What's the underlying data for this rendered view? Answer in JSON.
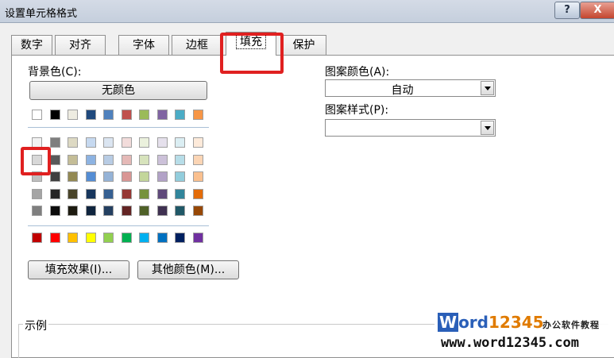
{
  "window": {
    "title": "设置单元格格式",
    "help_label": "?",
    "close_label": "X"
  },
  "tabs": [
    {
      "label": "数字"
    },
    {
      "label": "对齐"
    },
    {
      "label": "字体"
    },
    {
      "label": "边框"
    },
    {
      "label": "填充",
      "active": true
    },
    {
      "label": "保护"
    }
  ],
  "background": {
    "label": "背景色(C):",
    "no_color_button": "无颜色",
    "theme_row": [
      "#ffffff",
      "#000000",
      "#eeece1",
      "#1f497d",
      "#4f81bd",
      "#c0504d",
      "#9bbb59",
      "#8064a2",
      "#4bacc6",
      "#f79646"
    ],
    "shade_rows": [
      [
        "#f2f2f2",
        "#7f7f7f",
        "#ddd9c3",
        "#c6d9f0",
        "#dbe5f1",
        "#f2dcdb",
        "#ebf1dd",
        "#e5e0ec",
        "#dbeef3",
        "#fdeada"
      ],
      [
        "#d8d8d8",
        "#595959",
        "#c4bd97",
        "#8db3e2",
        "#b8cce4",
        "#e5b9b7",
        "#d7e3bc",
        "#ccc1d9",
        "#b7dde8",
        "#fbd5b5"
      ],
      [
        "#bfbfbf",
        "#3f3f3f",
        "#938953",
        "#548dd4",
        "#95b3d7",
        "#d99694",
        "#c3d69b",
        "#b2a2c7",
        "#92cddc",
        "#fac08f"
      ],
      [
        "#a5a5a5",
        "#262626",
        "#494429",
        "#17365d",
        "#366092",
        "#953734",
        "#76923c",
        "#5f497a",
        "#31859b",
        "#e36c09"
      ],
      [
        "#7f7f7f",
        "#0c0c0c",
        "#1d1b10",
        "#0f243e",
        "#244061",
        "#632423",
        "#4f6128",
        "#3f3151",
        "#205867",
        "#974806"
      ]
    ],
    "standard_row": [
      "#c00000",
      "#ff0000",
      "#ffc000",
      "#ffff00",
      "#92d050",
      "#00b050",
      "#00b0f0",
      "#0070c0",
      "#002060",
      "#7030a0"
    ]
  },
  "pattern": {
    "color_label": "图案颜色(A):",
    "color_value": "自动",
    "style_label": "图案样式(P):",
    "style_value": ""
  },
  "buttons": {
    "fill_effects": "填充效果(I)...",
    "more_colors": "其他颜色(M)..."
  },
  "sample": {
    "label": "示例"
  },
  "watermark": {
    "brand_w": "W",
    "brand_ord": "ord",
    "brand_num": "12345",
    "sub": "办公软件教程",
    "url": "www.word12345.com"
  }
}
